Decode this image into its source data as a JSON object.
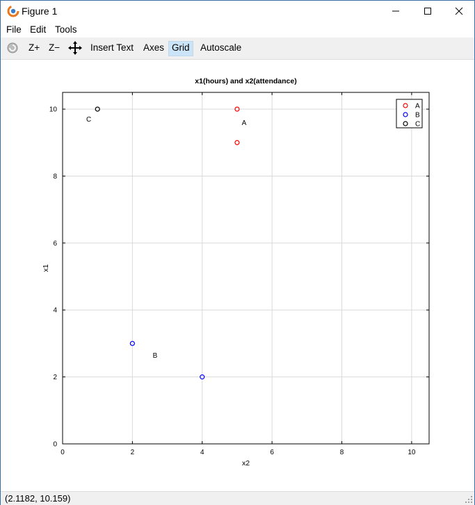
{
  "window": {
    "title": "Figure 1"
  },
  "menu": {
    "file": "File",
    "edit": "Edit",
    "tools": "Tools"
  },
  "toolbar": {
    "zoom_in": "Z+",
    "zoom_out": "Z−",
    "insert_text": "Insert Text",
    "axes": "Axes",
    "grid": "Grid",
    "autoscale": "Autoscale",
    "active_tool": "Grid"
  },
  "status": {
    "coords": "(2.1182, 10.159)"
  },
  "colors": {
    "A": "#ff0000",
    "B": "#0000ff",
    "C": "#000000",
    "accent": "#cce4f7"
  },
  "chart_data": {
    "type": "scatter",
    "title": "x1(hours) and x2(attendance)",
    "xlabel": "x2",
    "ylabel": "x1",
    "xlim": [
      0,
      10.5
    ],
    "ylim": [
      0,
      10.5
    ],
    "xticks": [
      0,
      2,
      4,
      6,
      8,
      10
    ],
    "yticks": [
      0,
      2,
      4,
      6,
      8,
      10
    ],
    "grid": true,
    "legend_position": "top-right",
    "series": [
      {
        "name": "A",
        "color": "#ff0000",
        "points": [
          [
            5,
            10
          ],
          [
            5,
            9
          ]
        ]
      },
      {
        "name": "B",
        "color": "#0000ff",
        "points": [
          [
            2,
            3
          ],
          [
            4,
            2
          ]
        ]
      },
      {
        "name": "C",
        "color": "#000000",
        "points": [
          [
            1,
            10
          ]
        ]
      }
    ],
    "annotations": [
      {
        "text": "A",
        "x": 5.2,
        "y": 9.6
      },
      {
        "text": "B",
        "x": 2.65,
        "y": 2.65
      },
      {
        "text": "C",
        "x": 0.75,
        "y": 9.7
      }
    ]
  }
}
